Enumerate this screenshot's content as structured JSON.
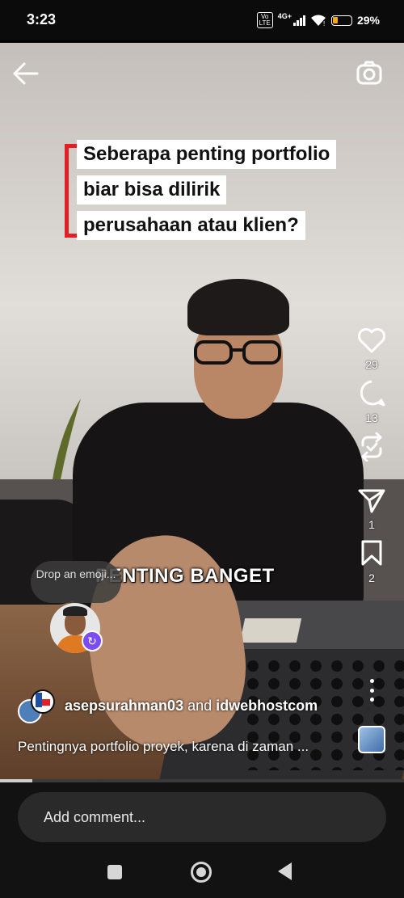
{
  "status_bar": {
    "time": "3:23",
    "volte": "Vo LTE",
    "network": "4G+",
    "battery_percent": "29%",
    "battery_level": 0.29
  },
  "video": {
    "title_lines": [
      "Seberapa penting portfolio",
      "biar bisa dilirik",
      "perusahaan atau klien?"
    ],
    "caption_overlay": "PENTING BANGET",
    "accent_color": "#e31e24",
    "progress": 0.08
  },
  "actions": {
    "likes": "29",
    "comments": "13",
    "reposts": "",
    "shares": "1",
    "saves": "2"
  },
  "emoji_prompt": {
    "text": "Drop an emoji..."
  },
  "post": {
    "author_primary": "asepsurahman03",
    "connector": "and",
    "author_secondary": "idwebhostcom",
    "description": "Pentingnya portfolio proyek, karena di zaman ..."
  },
  "comment": {
    "placeholder": "Add comment..."
  },
  "icons": [
    "back-arrow-icon",
    "camera-icon",
    "heart-icon",
    "comment-icon",
    "repost-icon",
    "share-icon",
    "bookmark-icon",
    "more-icon"
  ]
}
